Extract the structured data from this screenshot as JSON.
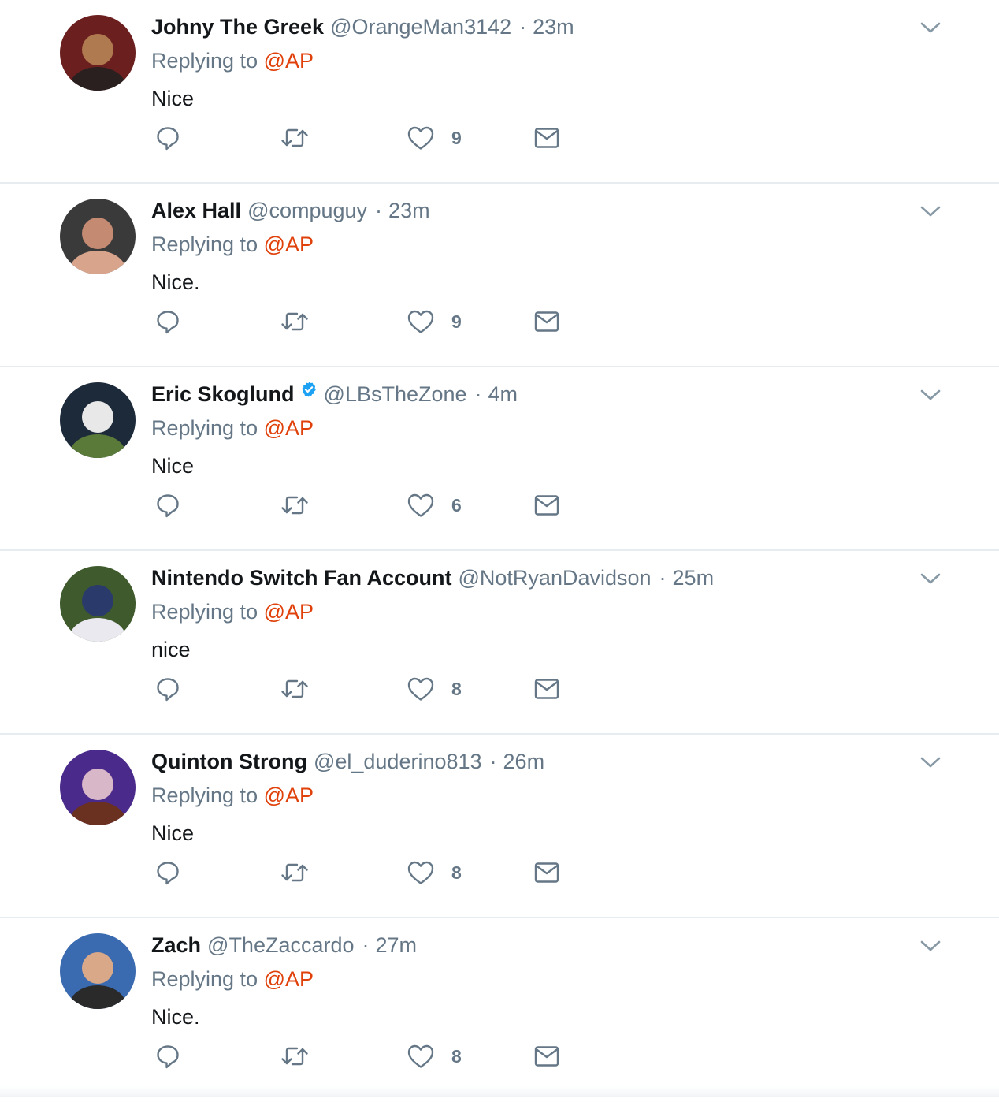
{
  "tweets": [
    {
      "name": "Johny The Greek",
      "handle": "@OrangeMan3142",
      "separator": "·",
      "time": "23m",
      "verified": false,
      "replying_prefix": "Replying to",
      "replying_to": "@AP",
      "text": "Nice",
      "likes": "9",
      "avatar_colors": [
        "#6b1f1f",
        "#2a2020",
        "#b07a50"
      ]
    },
    {
      "name": "Alex Hall",
      "handle": "@compuguy",
      "separator": "·",
      "time": "23m",
      "verified": false,
      "replying_prefix": "Replying to",
      "replying_to": "@AP",
      "text": "Nice.",
      "likes": "9",
      "avatar_colors": [
        "#3a3a3a",
        "#d9a48c",
        "#c58a72"
      ]
    },
    {
      "name": "Eric Skoglund",
      "handle": "@LBsTheZone",
      "separator": "·",
      "time": "4m",
      "verified": true,
      "replying_prefix": "Replying to",
      "replying_to": "@AP",
      "text": "Nice",
      "likes": "6",
      "avatar_colors": [
        "#1d2a3a",
        "#5a7a3a",
        "#e8e8e8"
      ]
    },
    {
      "name": "Nintendo Switch Fan Account",
      "handle": "@NotRyanDavidson",
      "separator": "·",
      "time": "25m",
      "verified": false,
      "replying_prefix": "Replying to",
      "replying_to": "@AP",
      "text": "nice",
      "likes": "8",
      "avatar_colors": [
        "#3f5a2c",
        "#e9e9ef",
        "#2a3a6a"
      ]
    },
    {
      "name": "Quinton Strong",
      "handle": "@el_duderino813",
      "separator": "·",
      "time": "26m",
      "verified": false,
      "replying_prefix": "Replying to",
      "replying_to": "@AP",
      "text": "Nice",
      "likes": "8",
      "avatar_colors": [
        "#4a2a8a",
        "#6a3020",
        "#d8b8c8"
      ]
    },
    {
      "name": "Zach",
      "handle": "@TheZaccardo",
      "separator": "·",
      "time": "27m",
      "verified": false,
      "replying_prefix": "Replying to",
      "replying_to": "@AP",
      "text": "Nice.",
      "likes": "8",
      "avatar_colors": [
        "#3a6ab0",
        "#2a2a2a",
        "#d9a888"
      ]
    }
  ],
  "icons": {
    "reply": "reply-icon",
    "retweet": "retweet-icon",
    "like": "heart-icon",
    "dm": "envelope-icon",
    "menu": "chevron-down-icon",
    "verified": "verified-badge-icon"
  },
  "colors": {
    "text": "#14171a",
    "muted": "#657786",
    "mention": "#e0410b",
    "divider": "#e6ecf0",
    "verified": "#1da1f2"
  }
}
